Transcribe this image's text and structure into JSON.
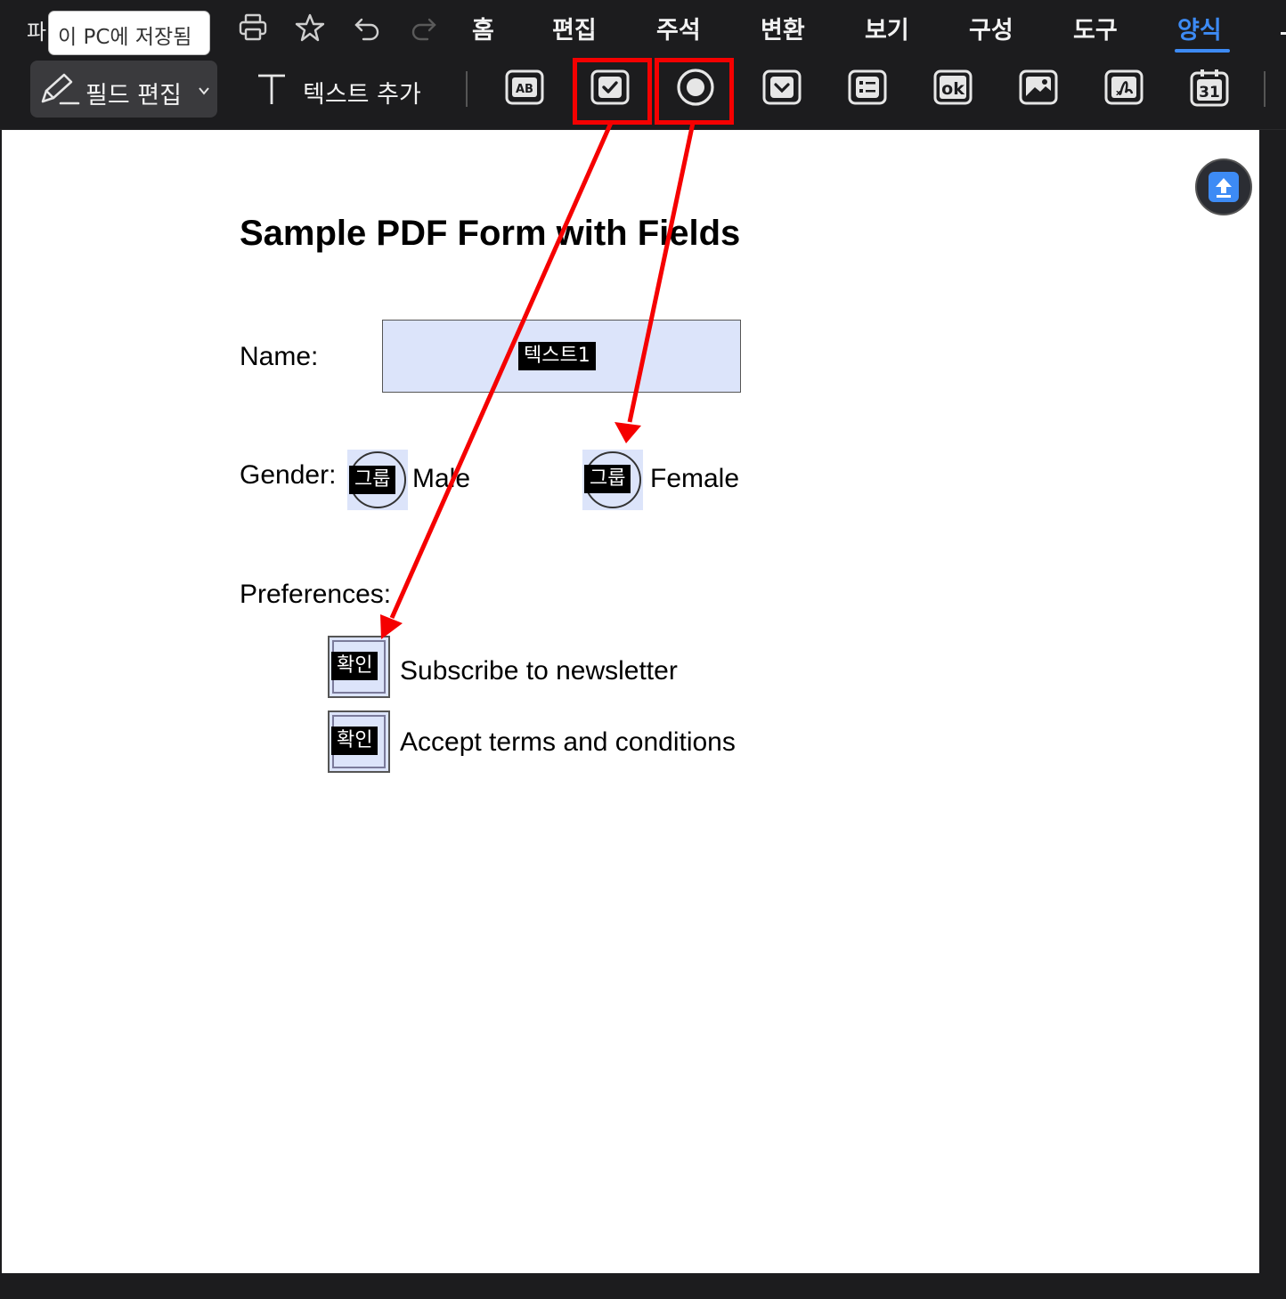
{
  "menubar": {
    "file_cut": "파",
    "tooltip": "이 PC에 저장됨",
    "quick_icons": [
      "print-icon",
      "star-icon",
      "undo-icon",
      "redo-icon"
    ],
    "items": [
      "홈",
      "편집",
      "주석",
      "변환",
      "보기",
      "구성",
      "도구",
      "양식"
    ],
    "active": "양식",
    "accent_color": "#3d8bf5"
  },
  "toolbar": {
    "field_edit_label": "필드 편집",
    "add_text_label": "텍스트 추가",
    "field_tools": [
      "text-field-icon",
      "checkbox-icon",
      "radio-button-icon",
      "dropdown-icon",
      "list-box-icon",
      "button-ok-icon",
      "image-field-icon",
      "signature-field-icon",
      "date-field-icon"
    ],
    "highlighted_tools": [
      "checkbox-icon",
      "radio-button-icon"
    ],
    "highlight_color": "#f50000"
  },
  "document": {
    "title": "Sample PDF Form with Fields",
    "name_label": "Name:",
    "text_field_tag": "텍스트1",
    "gender_label": "Gender:",
    "radio_group_tag": "그룹",
    "male_label": "Male",
    "female_label": "Female",
    "preferences_label": "Preferences:",
    "checkbox_tag": "확인",
    "subscribe_label": "Subscribe to newsletter",
    "accept_label": "Accept terms and conditions",
    "field_fill_color": "#dce4fa"
  },
  "floating": {
    "upload_icon": "upload-icon"
  }
}
